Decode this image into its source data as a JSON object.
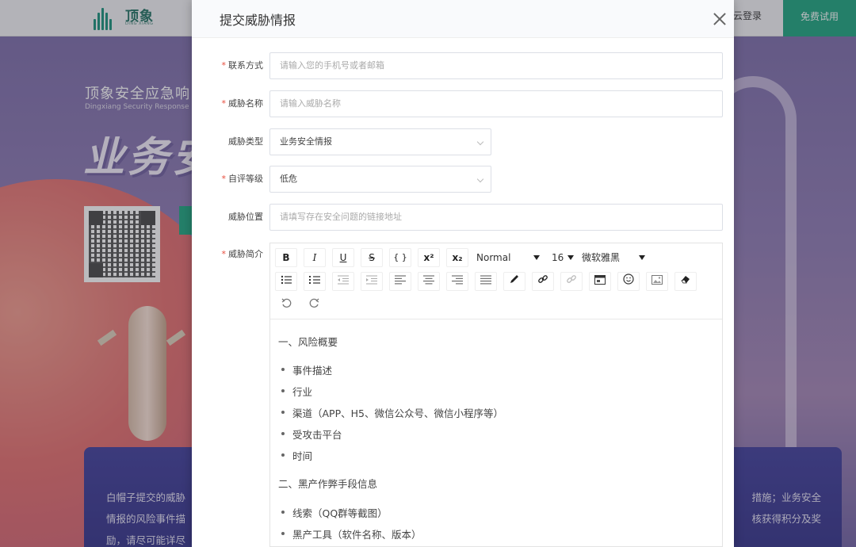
{
  "background": {
    "header": {
      "logo_cn": "顶象",
      "logo_en": "DING XIANG",
      "login_link": "云登录",
      "trial_button": "免费试用"
    },
    "hero": {
      "subtitle": "顶象安全应急响",
      "subtitle_en": "Dingxiang Security Response",
      "title": "业务安",
      "info_left_line1": "白帽子提交的威胁",
      "info_left_line2": "情报的风险事件描",
      "info_left_line3": "励，请尽可能详尽",
      "info_right_line1": "措施；业务安全",
      "info_right_line2": "核获得积分及奖",
      "info_right_line3": ""
    }
  },
  "modal": {
    "title": "提交威胁情报",
    "fields": {
      "contact": {
        "label": "联系方式",
        "placeholder": "请输入您的手机号或者邮箱",
        "required": true
      },
      "name": {
        "label": "威胁名称",
        "placeholder": "请输入威胁名称",
        "required": true
      },
      "type": {
        "label": "威胁类型",
        "value": "业务安全情报",
        "required": false
      },
      "level": {
        "label": "自评等级",
        "value": "低危",
        "required": true
      },
      "location": {
        "label": "威胁位置",
        "placeholder": "请填写存在安全问题的链接地址",
        "required": false
      },
      "summary": {
        "label": "威胁简介",
        "required": true
      }
    },
    "editor": {
      "toolbar": {
        "bold": "B",
        "italic": "I",
        "underline": "U",
        "strike": "S",
        "code": "{ }",
        "superscript": "x²",
        "subscript": "x₂",
        "heading_select": "Normal",
        "size_select": "16",
        "font_select": "微软雅黑"
      },
      "content": {
        "heading1": "一、风险概要",
        "items1": [
          "事件描述",
          "行业",
          "渠道（APP、H5、微信公众号、微信小程序等）",
          "受攻击平台",
          "时间"
        ],
        "heading2": "二、黑产作弊手段信息",
        "items2": [
          "线索（QQ群等截图）",
          "黑产工具（软件名称、版本）"
        ]
      }
    }
  }
}
